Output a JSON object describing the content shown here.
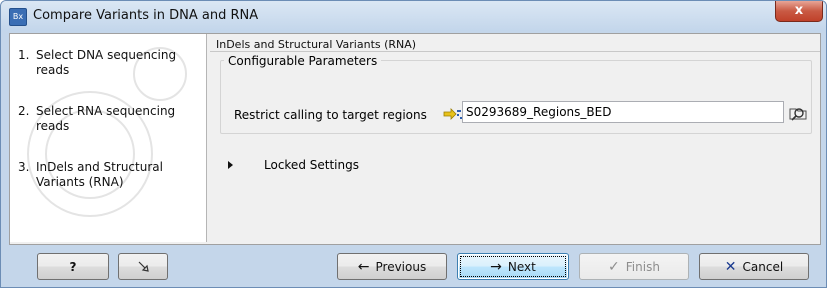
{
  "window": {
    "app_icon": "Bx",
    "title": "Compare Variants in DNA and RNA",
    "close_glyph": "x"
  },
  "steps": [
    {
      "num": "1.",
      "label": "Select DNA sequencing reads"
    },
    {
      "num": "2.",
      "label": "Select RNA sequencing reads"
    },
    {
      "num": "3.",
      "label": "InDels and Structural Variants (RNA)"
    }
  ],
  "content": {
    "section_title": "InDels and Structural Variants (RNA)",
    "group_title": "Configurable Parameters",
    "param_label": "Restrict calling to target regions",
    "param_value": "S0293689_Regions_BED",
    "param_icon": "annotation-track-icon",
    "browse_icon": "browse-folder-icon",
    "locked_settings": "Locked Settings"
  },
  "buttons": {
    "help": "?",
    "reset_icon": "reset-arrow-icon",
    "previous": "Previous",
    "next": "Next",
    "finish": "Finish",
    "cancel": "Cancel"
  },
  "colors": {
    "accent_blue": "#3c7fb1",
    "close_red": "#c0412a",
    "cancel_x": "#1a3a8f",
    "frame": "#c4d6ea"
  }
}
